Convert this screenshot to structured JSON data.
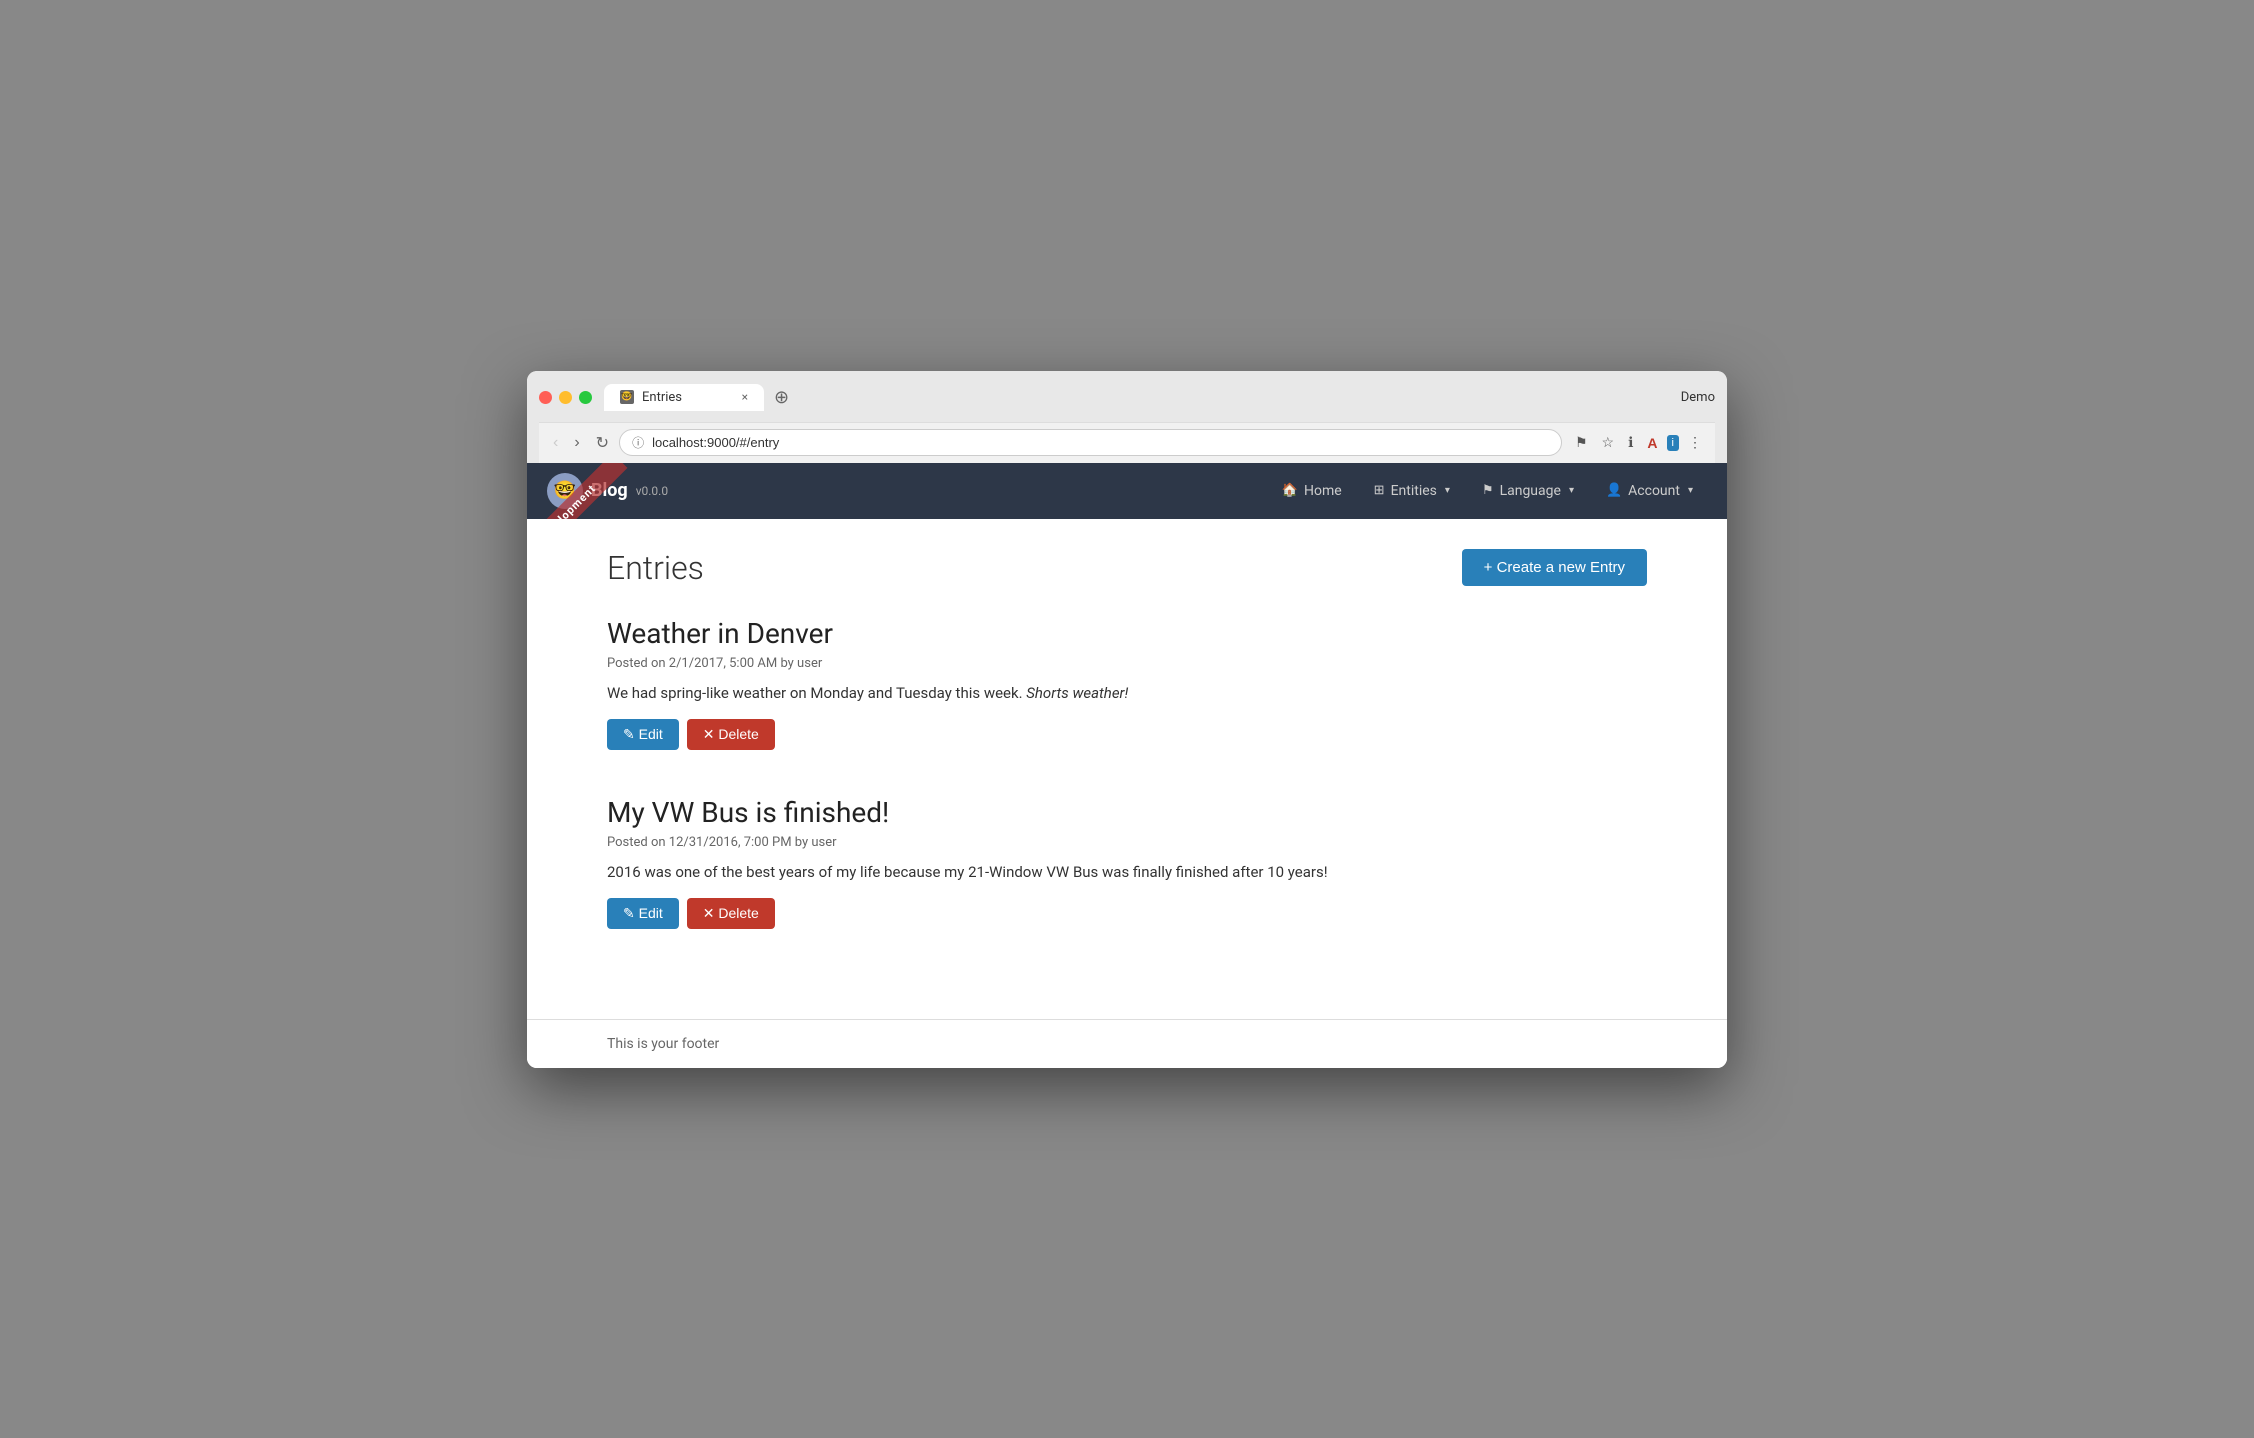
{
  "browser": {
    "tab_title": "Entries",
    "url": "localhost:9000/#/entry",
    "demo_label": "Demo",
    "close_icon": "×",
    "back_icon": "‹",
    "forward_icon": "›",
    "refresh_icon": "↺"
  },
  "navbar": {
    "brand_name": "Blog",
    "version": "v0.0.0",
    "ribbon_text": "Development",
    "nav_items": [
      {
        "label": "Home",
        "icon": "🏠"
      },
      {
        "label": "Entities",
        "icon": "⊞",
        "dropdown": true
      },
      {
        "label": "Language",
        "icon": "⚑",
        "dropdown": true
      },
      {
        "label": "Account",
        "icon": "👤",
        "dropdown": true
      }
    ]
  },
  "page": {
    "title": "Entries",
    "create_button": "+ Create a new Entry"
  },
  "entries": [
    {
      "title": "Weather in Denver",
      "meta": "Posted on 2/1/2017, 5:00 AM by user",
      "body_plain": "We had spring-like weather on Monday and Tuesday this week. ",
      "body_italic": "Shorts weather!",
      "edit_label": "✎ Edit",
      "delete_label": "✕ Delete"
    },
    {
      "title": "My VW Bus is finished!",
      "meta": "Posted on 12/31/2016, 7:00 PM by user",
      "body_plain": "2016 was one of the best years of my life because my 21-Window VW Bus was finally finished after 10 years!",
      "body_italic": "",
      "edit_label": "✎ Edit",
      "delete_label": "✕ Delete"
    }
  ],
  "footer": {
    "text": "This is your footer"
  }
}
